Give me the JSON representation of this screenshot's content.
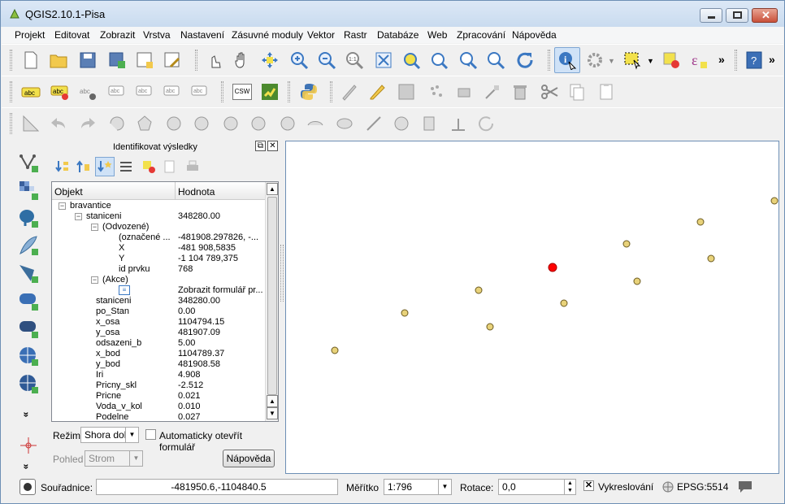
{
  "window": {
    "title": "QGIS2.10.1-Pisa"
  },
  "menu": [
    "Projekt",
    "Editovat",
    "Zobrazit",
    "Vrstva",
    "Nastavení",
    "Zásuvné moduly",
    "Vektor",
    "Rastr",
    "Databáze",
    "Web",
    "Zpracování",
    "Nápověda"
  ],
  "toolbar1": {
    "more": "»",
    "more2": "»"
  },
  "toolbar2": {
    "csw_label": "CSW",
    "abc_label": "abc"
  },
  "sidebar": {
    "more": "»"
  },
  "panel": {
    "title": "Identifikovat výsledky",
    "col_object": "Objekt",
    "col_value": "Hodnota",
    "rows": [
      {
        "name": "bravantice",
        "value": ""
      },
      {
        "name": "staniceni",
        "value": "348280.00"
      },
      {
        "name": "(Odvozené)",
        "value": ""
      },
      {
        "name": "(označené ...",
        "value": "-481908.297826, -..."
      },
      {
        "name": "X",
        "value": "-481 908,5835"
      },
      {
        "name": "Y",
        "value": "-1 104 789,375"
      },
      {
        "name": "id prvku",
        "value": "768"
      },
      {
        "name": "(Akce)",
        "value": ""
      },
      {
        "name": "",
        "value": "Zobrazit formulář pr..."
      },
      {
        "name": "staniceni",
        "value": "348280.00"
      },
      {
        "name": "po_Stan",
        "value": "0.00"
      },
      {
        "name": "x_osa",
        "value": "1104794.15"
      },
      {
        "name": "y_osa",
        "value": "481907.09"
      },
      {
        "name": "odsazeni_b",
        "value": "5.00"
      },
      {
        "name": "x_bod",
        "value": "1104789.37"
      },
      {
        "name": "y_bod",
        "value": "481908.58"
      },
      {
        "name": "Iri",
        "value": "4.908"
      },
      {
        "name": "Pricny_skl",
        "value": "-2.512"
      },
      {
        "name": "Pricne",
        "value": "0.021"
      },
      {
        "name": "Voda_v_kol",
        "value": "0.010"
      },
      {
        "name": "Podelne",
        "value": "0.027"
      }
    ],
    "mode_label": "Režim",
    "mode_value": "Shora dolů",
    "auto_open_label": "Automaticky otevřít formulář",
    "view_label": "Pohled",
    "view_value": "Strom",
    "help_button": "Nápověda"
  },
  "status": {
    "coords_label": "Souřadnice:",
    "coords_value": "-481950.6,-1104840.5",
    "scale_label": "Měřítko",
    "scale_value": "1:796",
    "rotation_label": "Rotace:",
    "rotation_value": "0,0",
    "render_label": "Vykreslování",
    "crs": "EPSG:5514"
  },
  "colors": {
    "point_fill": "#e8d27a",
    "point_stroke": "#6b5a20",
    "selected": "#ff0000",
    "accent": "#3b78c2"
  }
}
